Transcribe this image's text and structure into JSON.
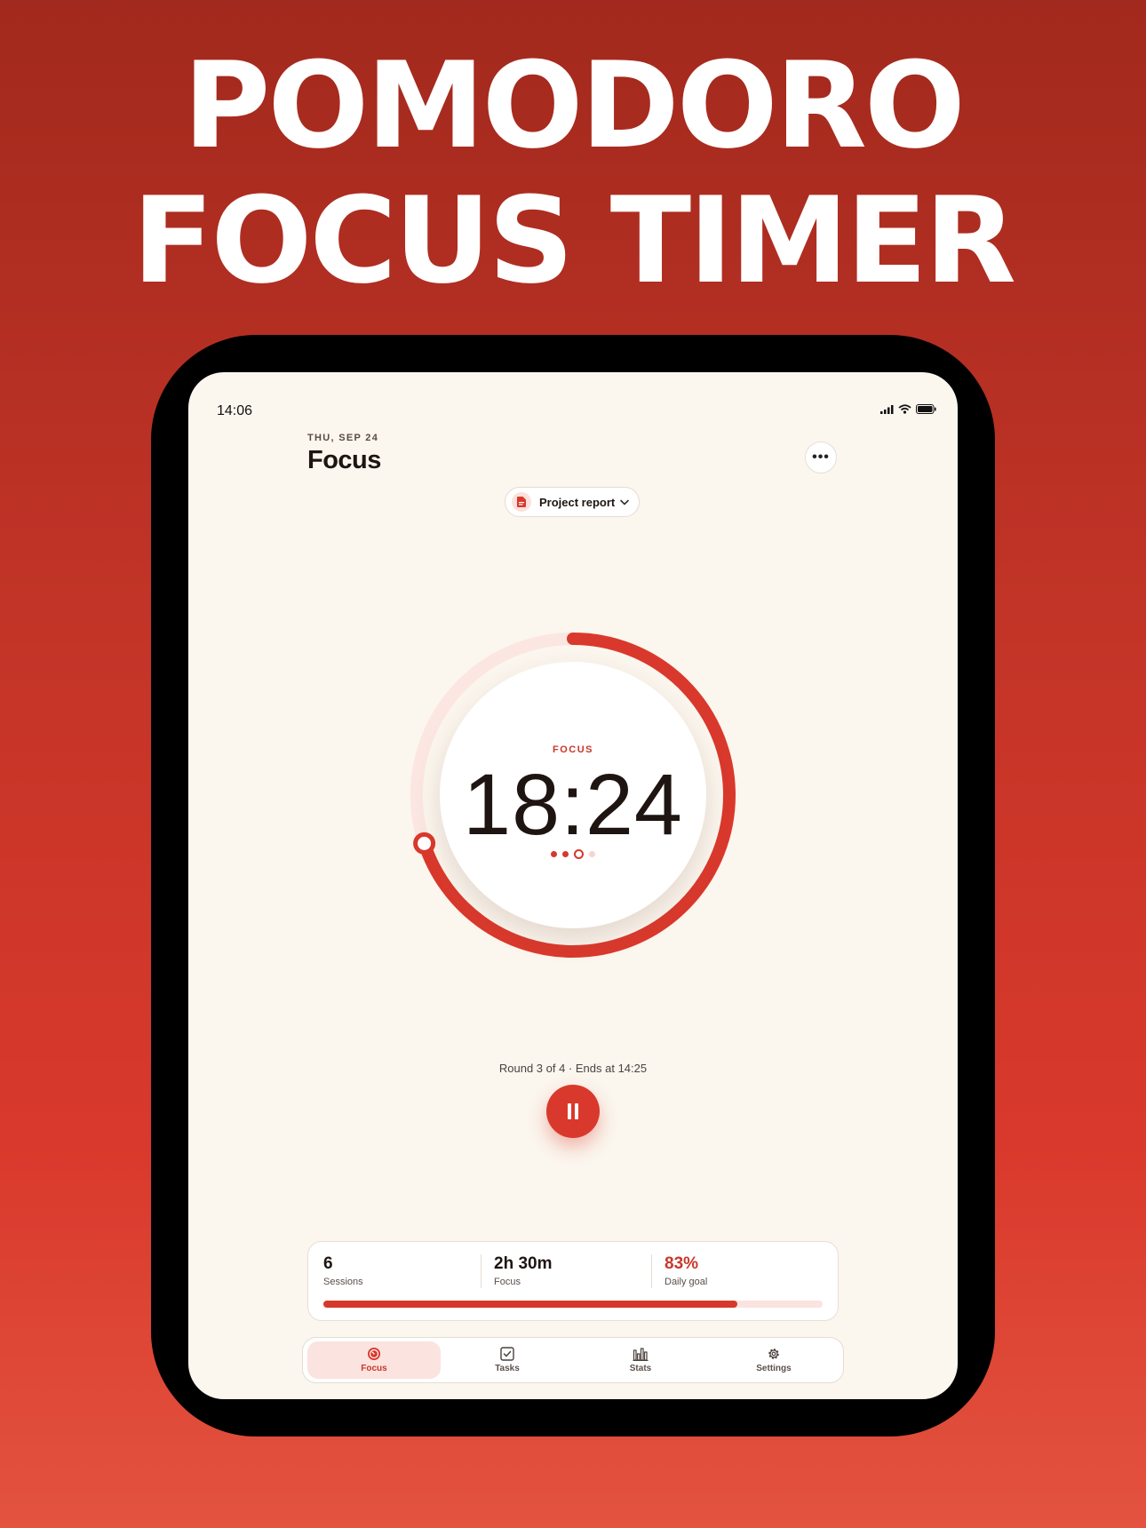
{
  "headline": {
    "line1": "POMODORO",
    "line2": "FOCUS TIMER"
  },
  "status_bar": {
    "time": "14:06",
    "icons": [
      "cellular-signal-icon",
      "wifi-icon",
      "battery-icon"
    ]
  },
  "header": {
    "date": "THU, SEP 24",
    "title": "Focus",
    "more_label": "•••"
  },
  "project": {
    "label": "Project report",
    "icon": "document-icon"
  },
  "timer": {
    "mode": "FOCUS",
    "time": "18:24",
    "progress": 0.7,
    "rounds_total": 4,
    "round_current": 3
  },
  "session_info": "Round 3 of 4 · Ends at 14:25",
  "controls": {
    "pause_icon": "pause-icon"
  },
  "stats": [
    {
      "value": "6",
      "label": "Sessions"
    },
    {
      "value": "2h 30m",
      "label": "Focus"
    },
    {
      "value": "83%",
      "label": "Daily goal"
    }
  ],
  "daily_goal_progress": 0.83,
  "tabs": [
    {
      "label": "Focus",
      "icon": "timer-icon",
      "active": true
    },
    {
      "label": "Tasks",
      "icon": "checkbox-icon",
      "active": false
    },
    {
      "label": "Stats",
      "icon": "bar-chart-icon",
      "active": false
    },
    {
      "label": "Settings",
      "icon": "gear-icon",
      "active": false
    }
  ],
  "colors": {
    "accent": "#d9392c",
    "accent_soft": "#fbe3df",
    "background": "#fbf6ee",
    "text": "#1e1512"
  }
}
